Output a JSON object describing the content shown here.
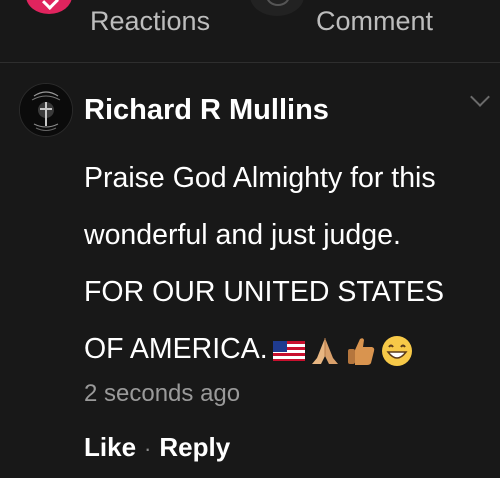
{
  "header": {
    "reactions_label": "Reactions",
    "comment_label": "Comment"
  },
  "comment": {
    "author": "Richard R Mullins",
    "lines": [
      "Praise God Almighty for this",
      "wonderful and just judge.",
      "FOR OUR UNITED STATES",
      "OF AMERICA."
    ],
    "emojis": [
      "us-flag-icon",
      "folded-hands-icon",
      "thumbs-up-icon",
      "grinning-face-icon"
    ],
    "timestamp": "2 seconds ago",
    "like_label": "Like",
    "separator": "·",
    "reply_label": "Reply"
  },
  "colors": {
    "background": "#181818",
    "reaction_accent": "#e0245e",
    "secondary_text": "#9a9a9a"
  }
}
